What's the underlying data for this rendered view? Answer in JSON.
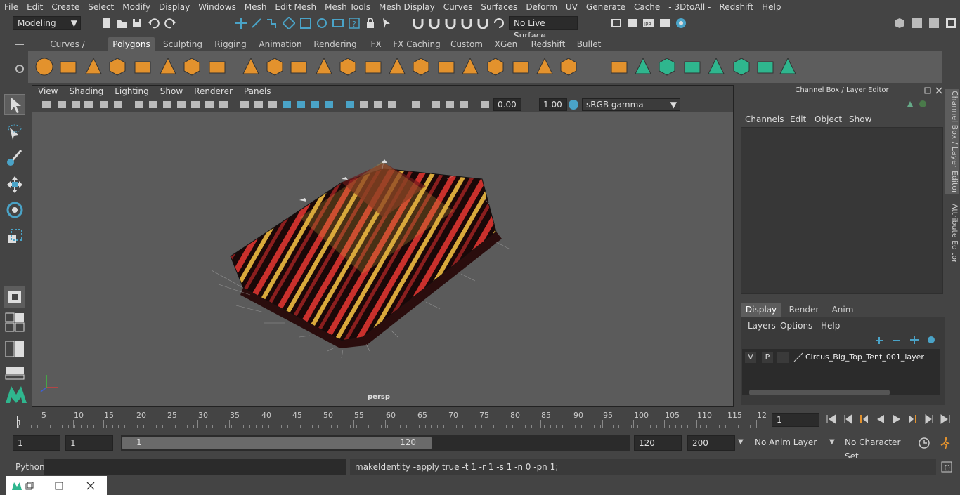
{
  "menubar": [
    "File",
    "Edit",
    "Create",
    "Select",
    "Modify",
    "Display",
    "Windows",
    "Mesh",
    "Edit Mesh",
    "Mesh Tools",
    "Mesh Display",
    "Curves",
    "Surfaces",
    "Deform",
    "UV",
    "Generate",
    "Cache",
    "- 3DtoAll -",
    "Redshift",
    "Help"
  ],
  "status": {
    "workspace": "Modeling",
    "live_surface": "No Live Surface"
  },
  "shelf_tabs": [
    "Curves / Surfaces",
    "Polygons",
    "Sculpting",
    "Rigging",
    "Animation",
    "Rendering",
    "FX",
    "FX Caching",
    "Custom",
    "XGen",
    "Redshift",
    "Bullet"
  ],
  "shelf_active": "Polygons",
  "viewport": {
    "menu": [
      "View",
      "Shading",
      "Lighting",
      "Show",
      "Renderer",
      "Panels"
    ],
    "exposure": "0.00",
    "gamma": "1.00",
    "colorspace": "sRGB gamma",
    "camera": "persp"
  },
  "channelbox": {
    "title": "Channel Box / Layer Editor",
    "menu": [
      "Channels",
      "Edit",
      "Object",
      "Show"
    ],
    "tabs": [
      "Display",
      "Render",
      "Anim"
    ],
    "layer_menu": [
      "Layers",
      "Options",
      "Help"
    ],
    "layer": {
      "v": "V",
      "p": "P",
      "name": "Circus_Big_Top_Tent_001_layer"
    }
  },
  "side_tabs": [
    "Channel Box / Layer Editor",
    "Attribute Editor"
  ],
  "timeline": {
    "ticks": [
      "5",
      "10",
      "15",
      "20",
      "25",
      "30",
      "35",
      "40",
      "45",
      "50",
      "55",
      "60",
      "65",
      "70",
      "75",
      "80",
      "85",
      "90",
      "95",
      "100",
      "105",
      "110",
      "115",
      "12"
    ],
    "start_mark": "1",
    "current_frame": "1"
  },
  "range": {
    "start": "1",
    "playback_start": "1",
    "slider_start": "1",
    "slider_end": "120",
    "end": "120",
    "total": "200",
    "anim_layer": "No Anim Layer",
    "char_set": "No Character Set"
  },
  "cmd": {
    "lang": "Python",
    "text": "makeIdentity -apply true -t 1 -r 1 -s 1 -n 0 -pn 1;"
  },
  "colors": {
    "bg": "#444444",
    "panel": "#5d5d5d",
    "accent": "#4aa3c7",
    "shelf_green": "#2fb68e",
    "orange": "#e3922d"
  }
}
